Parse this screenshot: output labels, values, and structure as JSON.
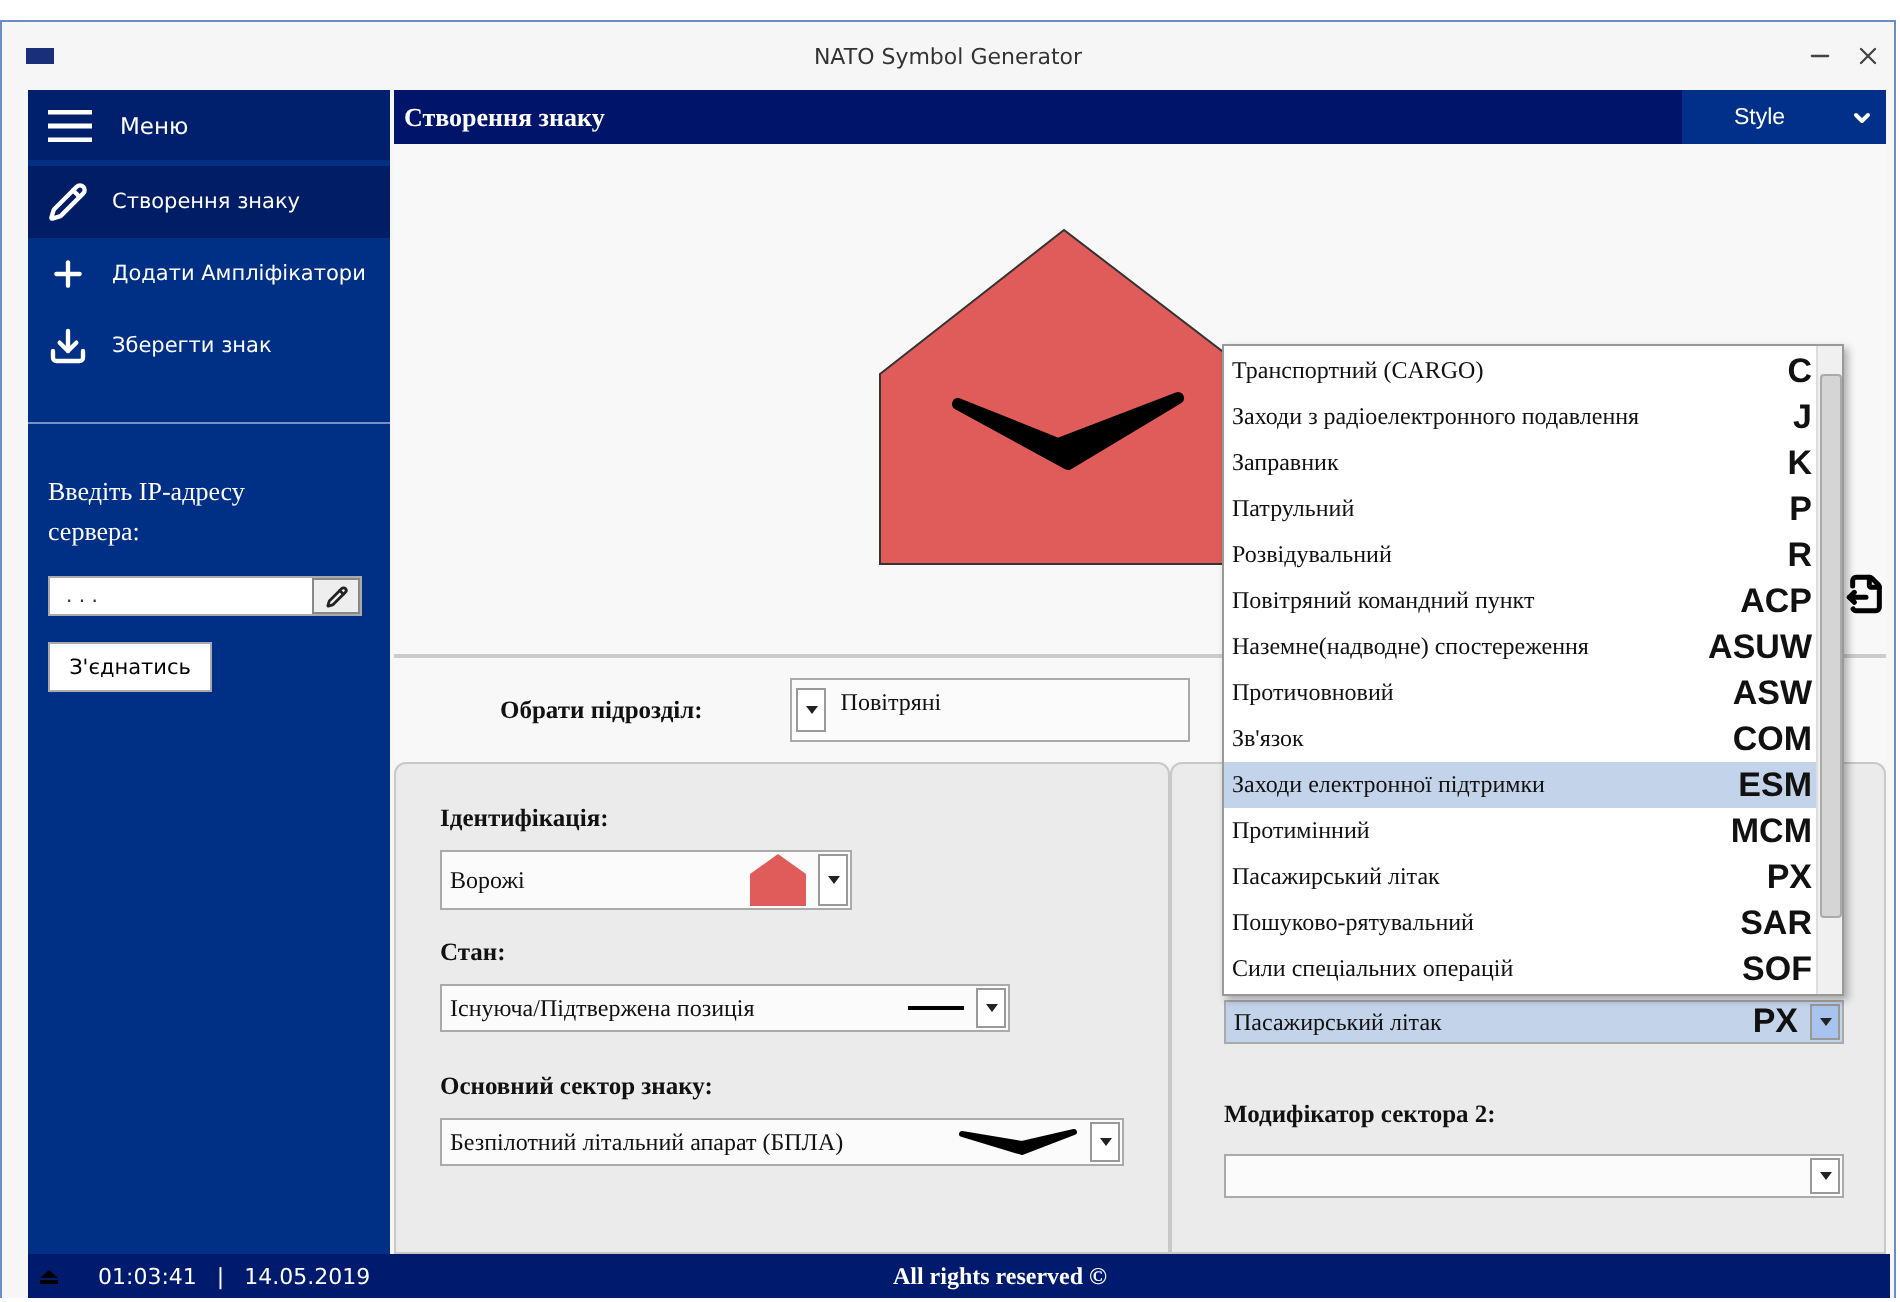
{
  "window": {
    "title": "NATO Symbol Generator"
  },
  "sidebar": {
    "menu_label": "Меню",
    "items": [
      {
        "label": "Створення знаку",
        "selected": true
      },
      {
        "label": "Додати Ампліфікатори",
        "selected": false
      },
      {
        "label": "Зберегти знак",
        "selected": false
      }
    ],
    "ip_label": "Введіть IP-адресу сервера:",
    "ip_value": ". . .",
    "connect_button": "З'єднатись"
  },
  "header": {
    "title": "Створення знаку",
    "style_button": "Style"
  },
  "unit_select": {
    "label": "Обрати підрозділ:",
    "value": "Повітряні"
  },
  "identification": {
    "label": "Ідентифікація:",
    "value": "Ворожі"
  },
  "status": {
    "label": "Стан:",
    "value": "Існуюча/Підтвержена позиція"
  },
  "main_sector": {
    "label": "Основний сектор знаку:",
    "value": "Безпілотний літальний апарат (БПЛА)"
  },
  "sector_modifier_1": {
    "value": "Пасажирський літак",
    "code": "PX"
  },
  "sector_modifier_2": {
    "label": "Модифікатор сектора 2:"
  },
  "dropdown": {
    "items": [
      {
        "label": "Транспортний (CARGO)",
        "code": "C",
        "selected": false
      },
      {
        "label": "Заходи з радіоелектронного подавлення",
        "code": "J",
        "selected": false
      },
      {
        "label": "Заправник",
        "code": "K",
        "selected": false
      },
      {
        "label": "Патрульний",
        "code": "P",
        "selected": false
      },
      {
        "label": "Розвідувальний",
        "code": "R",
        "selected": false
      },
      {
        "label": "Повітряний командний пункт",
        "code": "ACP",
        "selected": false
      },
      {
        "label": "Наземне(надводне) спостереження",
        "code": "ASUW",
        "selected": false
      },
      {
        "label": "Протичовновий",
        "code": "ASW",
        "selected": false
      },
      {
        "label": "Зв'язок",
        "code": "COM",
        "selected": false
      },
      {
        "label": "Заходи електронної підтримки",
        "code": "ESM",
        "selected": true
      },
      {
        "label": "Протимінний",
        "code": "MCM",
        "selected": false
      },
      {
        "label": "Пасажирський літак",
        "code": "PX",
        "selected": false
      },
      {
        "label": "Пошуково-рятувальний",
        "code": "SAR",
        "selected": false
      },
      {
        "label": "Сили спеціальних операцій",
        "code": "SOF",
        "selected": false
      }
    ]
  },
  "status_bar": {
    "time": "01:03:41",
    "separator": "|",
    "date": "14.05.2019",
    "copyright": "All rights reserved ©"
  }
}
